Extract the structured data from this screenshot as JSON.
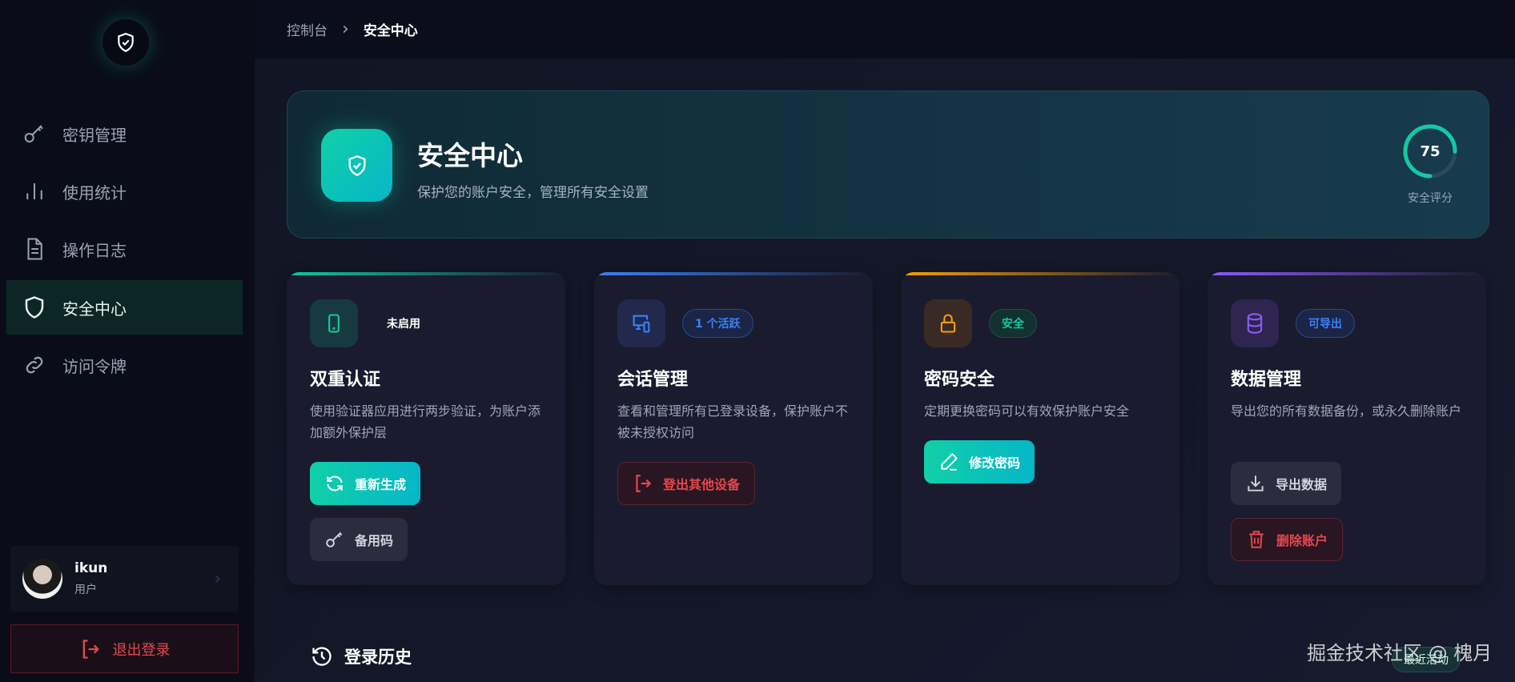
{
  "sidebar": {
    "items": [
      {
        "label": "密钥管理",
        "icon": "key-icon"
      },
      {
        "label": "使用统计",
        "icon": "bar-chart-icon"
      },
      {
        "label": "操作日志",
        "icon": "document-icon"
      },
      {
        "label": "安全中心",
        "icon": "shield-icon",
        "active": true
      },
      {
        "label": "访问令牌",
        "icon": "link-icon"
      }
    ],
    "user": {
      "name": "ikun",
      "role": "用户"
    },
    "logout_label": "退出登录"
  },
  "breadcrumb": {
    "parent": "控制台",
    "current": "安全中心"
  },
  "hero": {
    "title": "安全中心",
    "subtitle": "保护您的账户安全，管理所有安全设置",
    "score": 75,
    "score_label": "安全评分"
  },
  "cards": [
    {
      "title": "双重认证",
      "badge": "未启用",
      "desc": "使用验证器应用进行两步验证，为账户添加额外保护层",
      "buttons": [
        "重新生成",
        "备用码"
      ],
      "accent": "#10c9a0"
    },
    {
      "title": "会话管理",
      "badge": "1 个活跃",
      "desc": "查看和管理所有已登录设备，保护账户不被未授权访问",
      "buttons": [
        "登出其他设备"
      ],
      "accent": "#3b82f6"
    },
    {
      "title": "密码安全",
      "badge": "安全",
      "desc": "定期更换密码可以有效保护账户安全",
      "buttons": [
        "修改密码"
      ],
      "accent": "#f59e0b"
    },
    {
      "title": "数据管理",
      "badge": "可导出",
      "desc": "导出您的所有数据备份，或永久删除账户",
      "buttons": [
        "导出数据",
        "删除账户"
      ],
      "accent": "#8b5cf6"
    }
  ],
  "history": {
    "title": "登录历史",
    "recent_label": "最近活动"
  },
  "watermark": "掘金技术社区 @ 槐月"
}
